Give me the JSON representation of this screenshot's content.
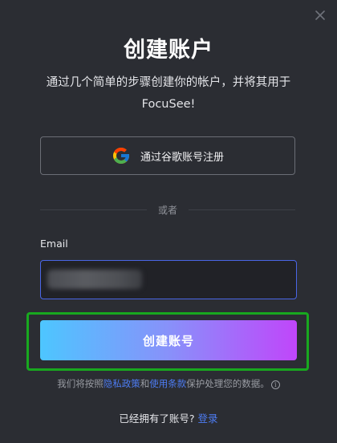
{
  "dialog": {
    "title": "创建账户",
    "subtitle": "通过几个简单的步骤创建你的帐户，并将其用于 FocuSee!",
    "close_icon": "close-icon"
  },
  "google_signup": {
    "label": "通过谷歌账号注册",
    "icon": "google-icon"
  },
  "divider": {
    "text": "或者"
  },
  "email": {
    "label": "Email",
    "value": "",
    "value_obscured": true
  },
  "create_button": {
    "label": "创建账号"
  },
  "legal": {
    "prefix": "我们将按照",
    "privacy_link": "隐私政策",
    "connector": "和",
    "terms_link": "使用条款",
    "suffix": "保护处理您的数据。",
    "info_icon": "info-icon"
  },
  "login": {
    "prompt": "已经拥有了账号?",
    "link": "登录"
  },
  "colors": {
    "background": "#2b2d33",
    "input_border": "#4a66e6",
    "link": "#4d7cf2",
    "gradient_start": "#4dc6ff",
    "gradient_end": "#c046fa",
    "highlight_outline": "#18a81f"
  }
}
